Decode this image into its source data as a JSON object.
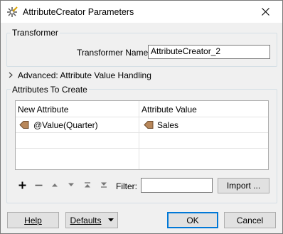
{
  "window": {
    "title": "AttributeCreator Parameters",
    "close_glyph": "✕"
  },
  "transformer_group": {
    "label": "Transformer",
    "name_label": "Transformer Name:",
    "name_value": "AttributeCreator_2"
  },
  "advanced": {
    "label": "Advanced: Attribute Value Handling",
    "expanded": false
  },
  "attributes_group": {
    "label": "Attributes To Create",
    "columns": [
      "New Attribute",
      "Attribute Value"
    ],
    "rows": [
      {
        "new_attribute": "@Value(Quarter)",
        "attribute_value": "Sales"
      },
      {
        "new_attribute": "",
        "attribute_value": ""
      }
    ]
  },
  "toolbar": {
    "add": "+",
    "remove": "—",
    "filter_label": "Filter:",
    "filter_value": "",
    "import_label": "Import ..."
  },
  "footer": {
    "help_label": "Help",
    "defaults_label": "Defaults",
    "ok_label": "OK",
    "cancel_label": "Cancel"
  },
  "colors": {
    "accent": "#0078d7",
    "tag_icon": "#b8875a"
  }
}
